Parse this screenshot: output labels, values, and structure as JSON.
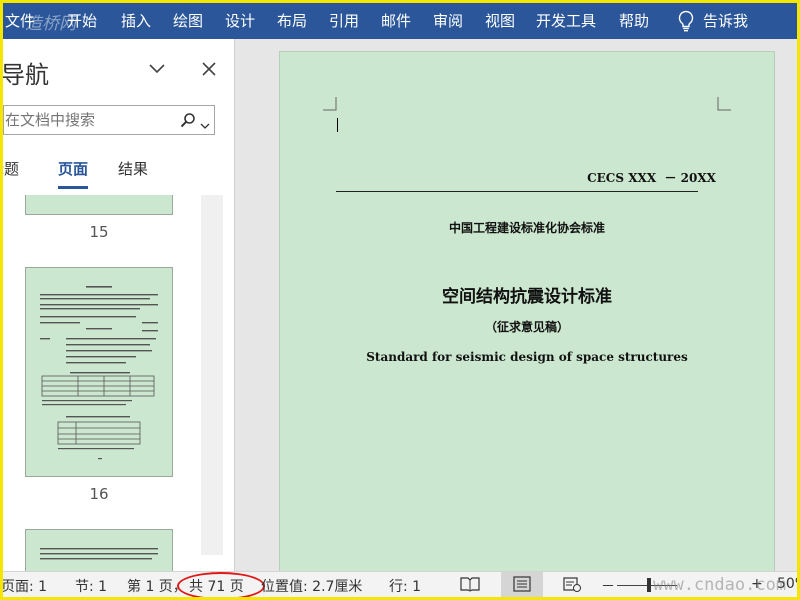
{
  "ribbon": {
    "tabs": [
      "文件",
      "开始",
      "插入",
      "绘图",
      "设计",
      "布局",
      "引用",
      "邮件",
      "审阅",
      "视图",
      "开发工具",
      "帮助"
    ],
    "tell_me": "告诉我"
  },
  "nav": {
    "title": "导航",
    "search_placeholder": "在文档中搜索",
    "tabs": [
      "标题",
      "页面",
      "结果"
    ],
    "active_tab": "页面",
    "pages": [
      "15",
      "16"
    ]
  },
  "document": {
    "std_code": "CECS XXX  － 20XX",
    "association": "中国工程建设标准化协会标准",
    "title": "空间结构抗震设计标准",
    "subtitle": "（征求意见稿）",
    "english_title": "Standard for seismic design of space structures"
  },
  "status": {
    "page": "页面: 1",
    "section": "节: 1",
    "page_of": "第 1 页，",
    "total": "共 71 页",
    "position": "位置值: 2.7厘米",
    "line": "行: 1",
    "zoom_minus": "－",
    "zoom_plus": "+",
    "zoom_value": "50%"
  },
  "watermarks": {
    "top": "造桥网",
    "bottom": "www.cndao.com"
  },
  "colors": {
    "ribbon": "#2b579a",
    "page_bg": "#cce7cf",
    "highlight": "#e01818",
    "frame": "#f5e600"
  }
}
